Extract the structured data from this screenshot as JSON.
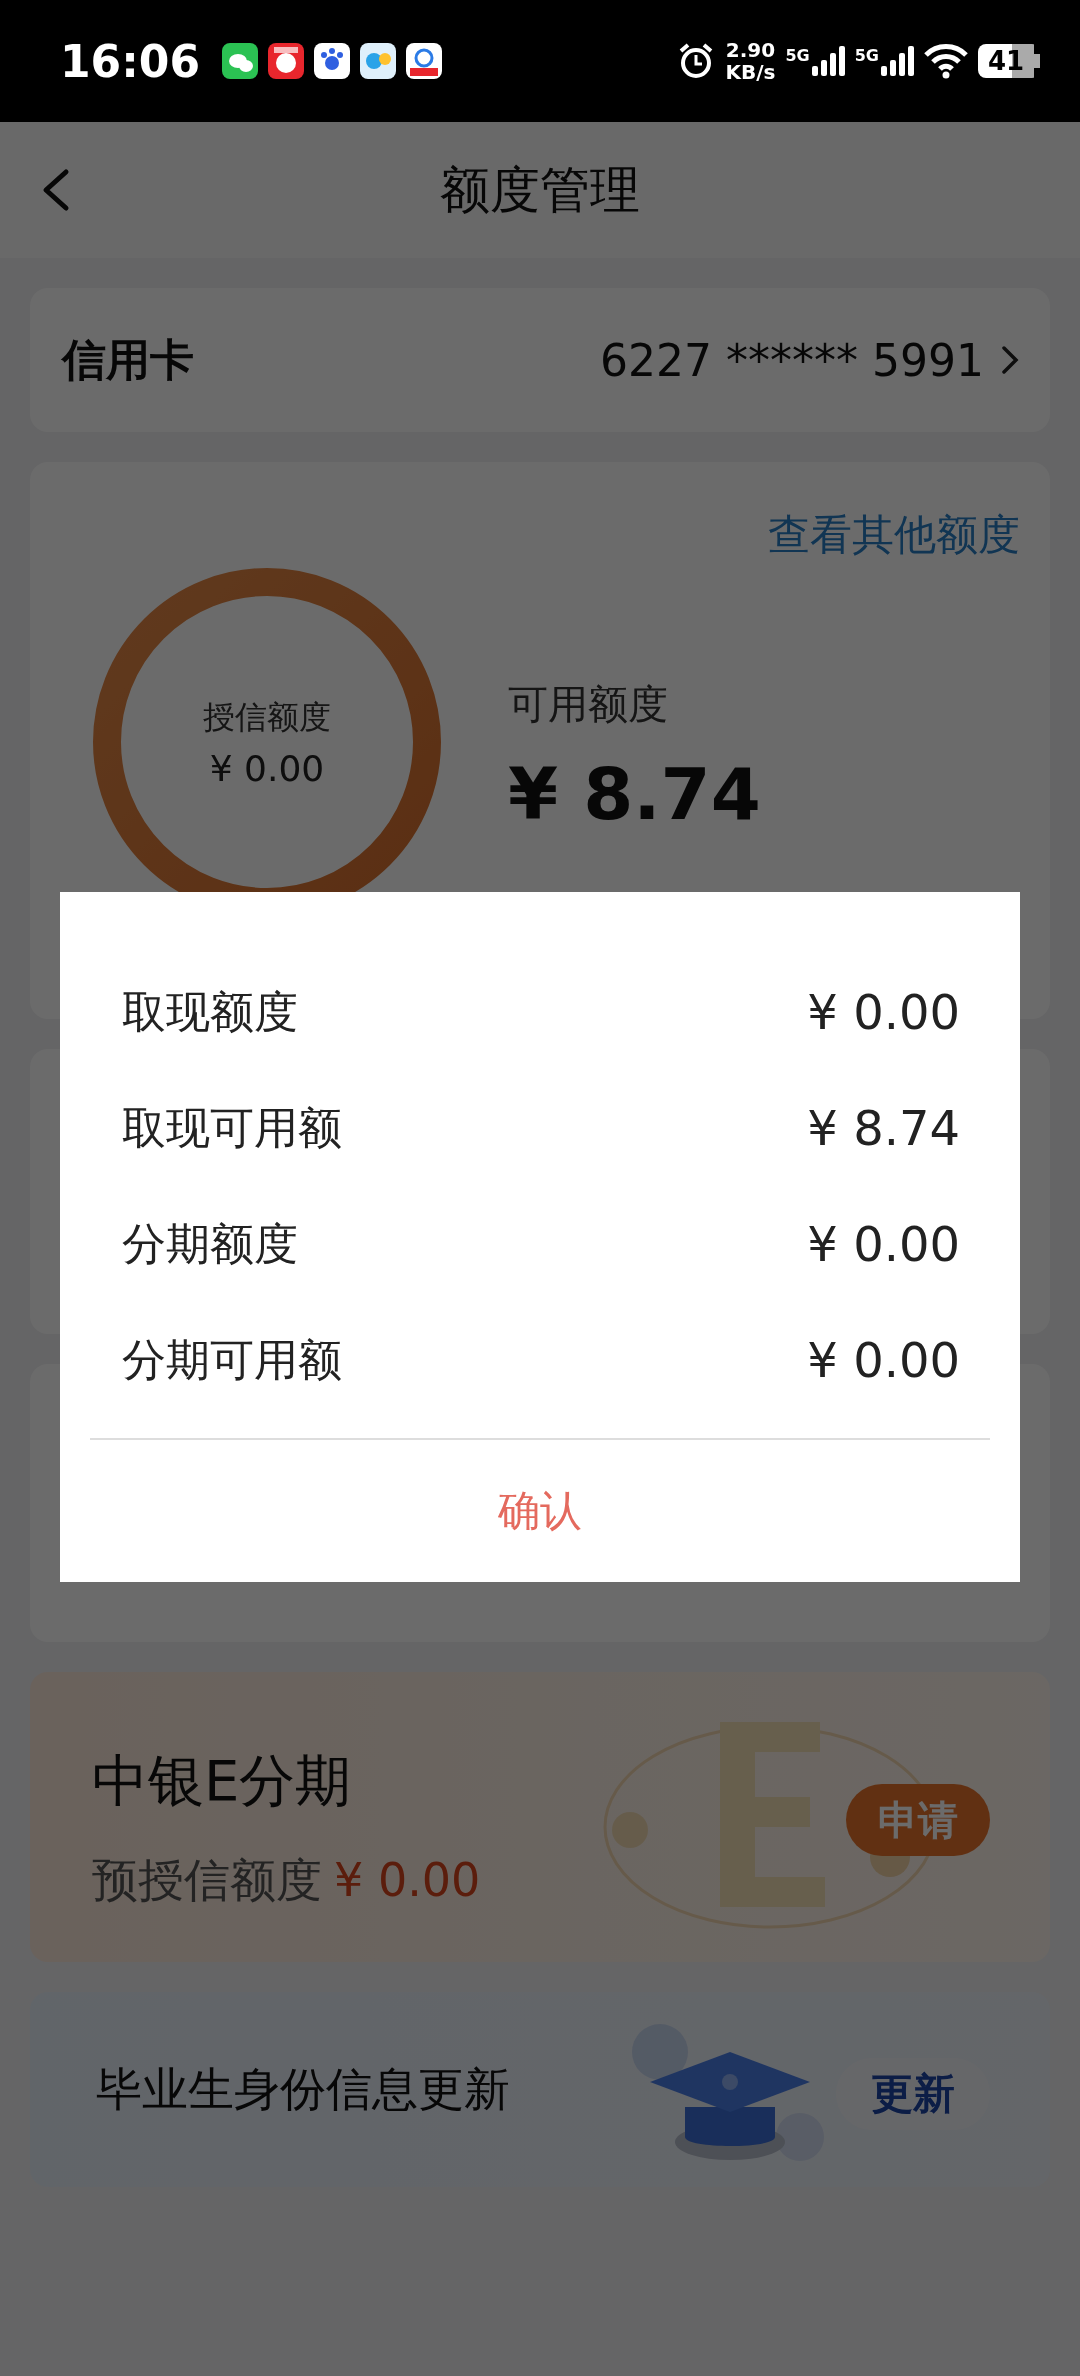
{
  "status_bar": {
    "time": "16:06",
    "speed_value": "2.90",
    "speed_unit": "KB/s",
    "networks": [
      "5G",
      "5G"
    ],
    "battery": "41"
  },
  "header": {
    "title": "额度管理"
  },
  "card_row": {
    "label": "信用卡",
    "number": "6227 ****** 5991"
  },
  "limits": {
    "link": "查看其他额度",
    "ring_label": "授信额度",
    "ring_value": "¥ 0.00",
    "available_label": "可用额度",
    "available_value": "¥ 8.74"
  },
  "promo": {
    "title": "中银E分期",
    "subtitle": "预授信额度",
    "amount": "¥ 0.00",
    "button": "申请"
  },
  "update": {
    "title": "毕业生身份信息更新",
    "button": "更新"
  },
  "dialog": {
    "rows": [
      {
        "label": "取现额度",
        "value": "¥ 0.00"
      },
      {
        "label": "取现可用额",
        "value": "¥ 8.74"
      },
      {
        "label": "分期额度",
        "value": "¥ 0.00"
      },
      {
        "label": "分期可用额",
        "value": "¥ 0.00"
      }
    ],
    "confirm": "确认"
  }
}
